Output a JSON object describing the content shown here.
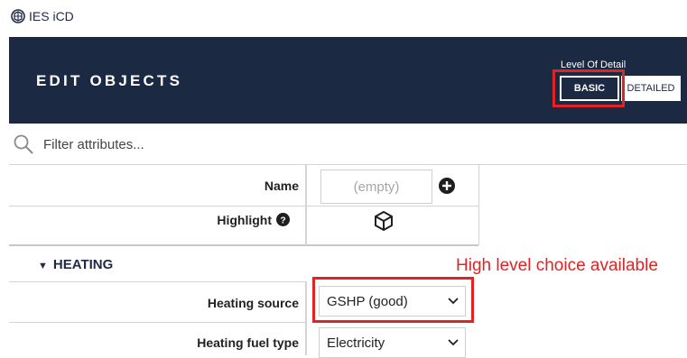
{
  "app": {
    "title": "IES iCD",
    "logo_icon": "ies-logo-icon"
  },
  "header": {
    "title": "EDIT OBJECTS",
    "level_of_detail": {
      "label": "Level Of Detail",
      "options": [
        "BASIC",
        "DETAILED"
      ],
      "selected": "BASIC"
    }
  },
  "filter": {
    "placeholder": "Filter attributes..."
  },
  "attributes": {
    "name": {
      "label": "Name",
      "placeholder": "(empty)"
    },
    "highlight": {
      "label": "Highlight"
    }
  },
  "section": {
    "label": "HEATING",
    "expanded": true
  },
  "heating": {
    "source": {
      "label": "Heating source",
      "value": "GSHP (good)"
    },
    "fuel_type": {
      "label": "Heating fuel type",
      "value": "Electricity"
    }
  },
  "annotation": {
    "text": "High level choice available",
    "color": "#e02323"
  },
  "colors": {
    "header_bg": "#1c2942",
    "highlight_red": "#e02323"
  }
}
